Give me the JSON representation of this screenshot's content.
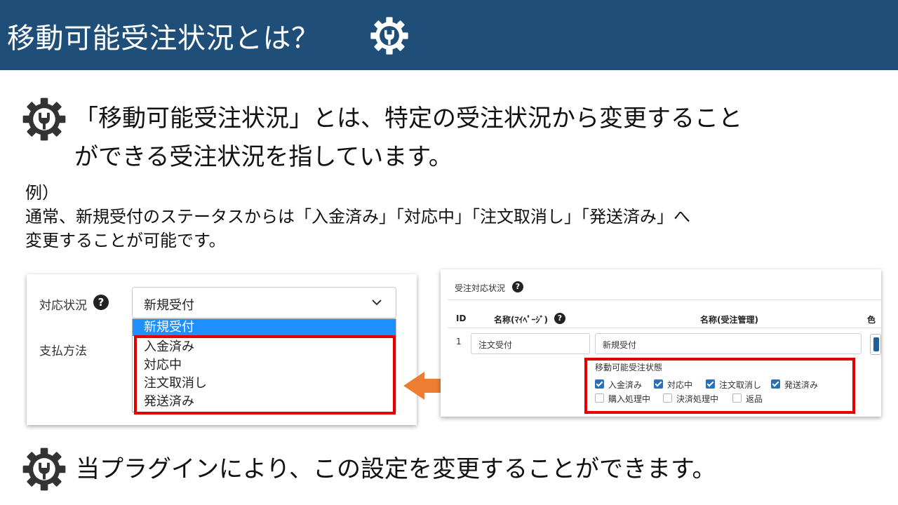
{
  "header": {
    "title": "移動可能受注状況とは？"
  },
  "intro": {
    "line1": "「移動可能受注状況」とは、特定の受注状況から変更すること",
    "line2": "ができる受注状況を指しています。"
  },
  "example": {
    "heading": "例）",
    "line1": "通常、新規受付のステータスからは「入金済み」「対応中」「注文取消し」「発送済み」へ",
    "line2": "変更することが可能です。"
  },
  "left_screenshot": {
    "status_label": "対応状況",
    "help": "?",
    "payment_label": "支払方法",
    "select_value": "新規受付",
    "options": [
      "新規受付",
      "入金済み",
      "対応中",
      "注文取消し",
      "発送済み"
    ],
    "selected_index": 0
  },
  "right_screenshot": {
    "section_title": "受注対応状況",
    "help": "?",
    "col_id": "ID",
    "col_name_mypage": "名称(ﾏｲﾍﾟｰｼﾞ)",
    "col_name_admin": "名称(受注管理)",
    "col_color": "色",
    "row_id": "1",
    "row_name_mypage": "注文受付",
    "row_name_admin": "新規受付",
    "movable_label": "移動可能受注状態",
    "checkboxes": [
      {
        "label": "入金済み",
        "checked": true
      },
      {
        "label": "対応中",
        "checked": true
      },
      {
        "label": "注文取消し",
        "checked": true
      },
      {
        "label": "発送済み",
        "checked": true
      },
      {
        "label": "購入処理中",
        "checked": false
      },
      {
        "label": "決済処理中",
        "checked": false
      },
      {
        "label": "返品",
        "checked": false
      }
    ]
  },
  "footer": {
    "text": "当プラグインにより、この設定を変更することができます。"
  },
  "colors": {
    "header_bg": "#1f4e79",
    "highlight": "#e30000",
    "arrow": "#ed7d31",
    "selected": "#1e90ff",
    "checkbox": "#2a6fb8"
  },
  "icons": [
    "gear-icon",
    "help-icon",
    "chevron-down-icon",
    "arrow-left-icon"
  ]
}
